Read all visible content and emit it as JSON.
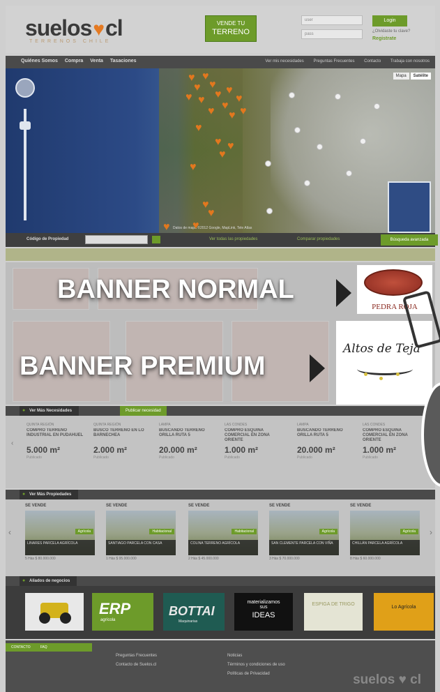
{
  "header": {
    "logo_text_left": "suelos",
    "logo_heart": "♥",
    "logo_text_right": "cl",
    "logo_sub": "TERRENOS CHILE",
    "vender_small": "VENDE TU",
    "vender_big": "TERRENO",
    "user_placeholder": "user",
    "pass_placeholder": "pass",
    "login_label": "Login",
    "forgot_label": "¿Olvidaste tu clave?",
    "register_label": "Registrate"
  },
  "nav": {
    "left": [
      "Quiénes Somos",
      "Compra",
      "Venta",
      "Tasaciones"
    ],
    "right": [
      "Ver mis necesidades",
      "Preguntas Frecuentes",
      "Contacto",
      "Trabaja con nosotros"
    ]
  },
  "map": {
    "type_buttons": [
      "Mapa",
      "Satélite"
    ],
    "attribution": "Datos de mapa ©2012 Google, MapLink, Tele Atlas"
  },
  "mapbar": {
    "code_label": "Código de Propiedad",
    "link_all": "Ver todas las propiedades",
    "link_compare": "Comparar propiedades",
    "search_label": "Búsqueda avanzada"
  },
  "banners": {
    "normal_label": "BANNER NORMAL",
    "premium_label": "BANNER PREMIUM",
    "pedra_name": "PEDRA ROJA",
    "altos_name": "Altos de Teja"
  },
  "needs": {
    "tab_label": "Ver Más Necesidades",
    "tab2_label": "Publicar necesidad",
    "items": [
      {
        "loc": "QUINTA REGIÓN",
        "title": "COMPRO TERRENO INDUSTRIAL EN PUDAHUEL",
        "area": "5.000 m²",
        "date": "Publicado"
      },
      {
        "loc": "QUINTA REGIÓN",
        "title": "BUSCO TERRENO EN LO BARNECHEA",
        "area": "2.000 m²",
        "date": "Publicado"
      },
      {
        "loc": "LAMPA",
        "title": "BUSCANDO TERRENO ORILLA RUTA 5",
        "area": "20.000 m²",
        "date": "Publicado"
      },
      {
        "loc": "LAS CONDES",
        "title": "COMPRO ESQUINA COMERCIAL EN ZONA ORIENTE",
        "area": "1.000 m²",
        "date": "Publicado"
      },
      {
        "loc": "LAMPA",
        "title": "BUSCANDO TERRENO ORILLA RUTA 5",
        "area": "20.000 m²",
        "date": "Publicado"
      },
      {
        "loc": "LAS CONDES",
        "title": "COMPRO ESQUINA COMERCIAL EN ZONA ORIENTE",
        "area": "1.000 m²",
        "date": "Publicado"
      }
    ]
  },
  "props": {
    "tab_label": "Ver Más Propiedades",
    "items": [
      {
        "head": "SE VENDE",
        "tag": "Agrícola",
        "cap": "LINARES PARCELA AGRÍCOLA",
        "meta": "5 Hás  $ 80.000.000"
      },
      {
        "head": "SE VENDE",
        "tag": "Habitacional",
        "cap": "SANTIAGO PARCELA CON CASA",
        "meta": "1 Hás  $ 95.000.000"
      },
      {
        "head": "SE VENDE",
        "tag": "Habitacional",
        "cap": "COLINA TERRENO AGRÍCOLA",
        "meta": "2 Hás  $ 45.000.000"
      },
      {
        "head": "SE VENDE",
        "tag": "Agrícola",
        "cap": "SAN CLEMENTE PARCELA CON VIÑA",
        "meta": "3 Hás  $ 70.000.000"
      },
      {
        "head": "SE VENDE",
        "tag": "Agrícola",
        "cap": "CHILLÁN PARCELA AGRÍCOLA",
        "meta": "8 Hás  $ 60.000.000"
      }
    ]
  },
  "allies": {
    "tab_label": "Aliados de negocios",
    "erp_big": "ERP",
    "erp_small": "agrícola",
    "bottai_big": "BOTTAI",
    "bottai_small": "Maquinarias",
    "ideas_line1": "materializamos",
    "ideas_line2": "sus",
    "ideas_line3": "IDEAS",
    "espiga": "ESPIGA DE TRIGO",
    "yellow": "Lo Agrícola"
  },
  "footer": {
    "tags": [
      "CONTACTO",
      "FAQ"
    ],
    "col1": [
      "Preguntas Frecuentes",
      "Contacto de Suelos.cl"
    ],
    "col2": [
      "Noticias",
      "Términos y condiciones de uso",
      "Políticas de Privacidad"
    ],
    "logo_left": "suelos",
    "logo_heart": "♥",
    "logo_right": "cl"
  }
}
